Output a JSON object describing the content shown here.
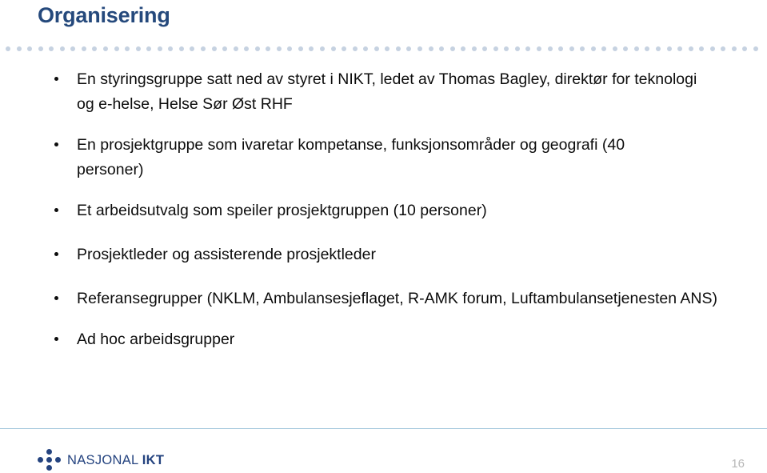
{
  "slide": {
    "title": "Organisering",
    "page_number": "16",
    "title_color": "#25497c",
    "divider_dot_color": "#c6d2e1",
    "footer_rule_color": "#a7cade",
    "logo_color": "#24437f",
    "page_number_color": "#b7b7b7",
    "body_text_color": "#0d0d0d"
  },
  "bullets": [
    {
      "text": "En styringsgruppe satt ned av styret i NIKT, ledet av Thomas Bagley, direktør for teknologi og e-helse, Helse Sør Øst RHF"
    },
    {
      "text": "En prosjektgruppe som ivaretar kompetanse, funksjonsområder og geografi (40 personer)"
    },
    {
      "text": "Et arbeidsutvalg som speiler prosjektgruppen (10 personer)"
    },
    {
      "text": "Prosjektleder og assisterende prosjektleder"
    },
    {
      "text": "Referansegrupper (NKLM, Ambulansesjeflaget, R-AMK forum, Luftambulansetjenesten ANS)"
    },
    {
      "text": "Ad hoc arbeidsgrupper"
    }
  ],
  "footer": {
    "logo_name_regular": "NASJONAL",
    "logo_name_bold": "IKT"
  }
}
